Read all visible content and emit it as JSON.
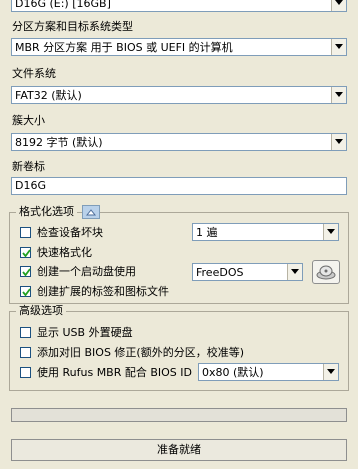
{
  "device": {
    "value": "D16G (E:) [16GB]"
  },
  "partition_scheme": {
    "label": "分区方案和目标系统类型",
    "value": "MBR 分区方案 用于 BIOS 或 UEFI 的计算机"
  },
  "file_system": {
    "label": "文件系统",
    "value": "FAT32 (默认)"
  },
  "cluster_size": {
    "label": "簇大小",
    "value": "8192 字节 (默认)"
  },
  "volume_label": {
    "label": "新卷标",
    "value": "D16G"
  },
  "format_options": {
    "legend": "格式化选项",
    "toggle_icon": "collapse-up-icon",
    "check_bad_blocks": {
      "label": "检查设备坏块",
      "checked": false,
      "passes": "1 遍"
    },
    "quick_format": {
      "label": "快速格式化",
      "checked": true
    },
    "create_bootable": {
      "label": "创建一个启动盘使用",
      "checked": true,
      "boot_type": "FreeDOS",
      "select_icon": "disk-image-icon"
    },
    "extended_label": {
      "label": "创建扩展的标签和图标文件",
      "checked": true
    }
  },
  "advanced": {
    "legend": "高级选项",
    "usb_hdd": {
      "label": "显示 USB 外置硬盘",
      "checked": false
    },
    "bios_fix": {
      "label": "添加对旧 BIOS 修正(额外的分区，校准等)",
      "checked": false
    },
    "rufus_mbr": {
      "label": "使用 Rufus MBR 配合 BIOS ID",
      "checked": false,
      "bios_id": "0x80 (默认)"
    }
  },
  "progress": {
    "value": 0
  },
  "status": {
    "text": "准备就绪"
  },
  "colors": {
    "window_bg": "#ece9d8",
    "field_border": "#7f9db9",
    "check_border": "#1c5180",
    "check_mark": "#21a121"
  }
}
